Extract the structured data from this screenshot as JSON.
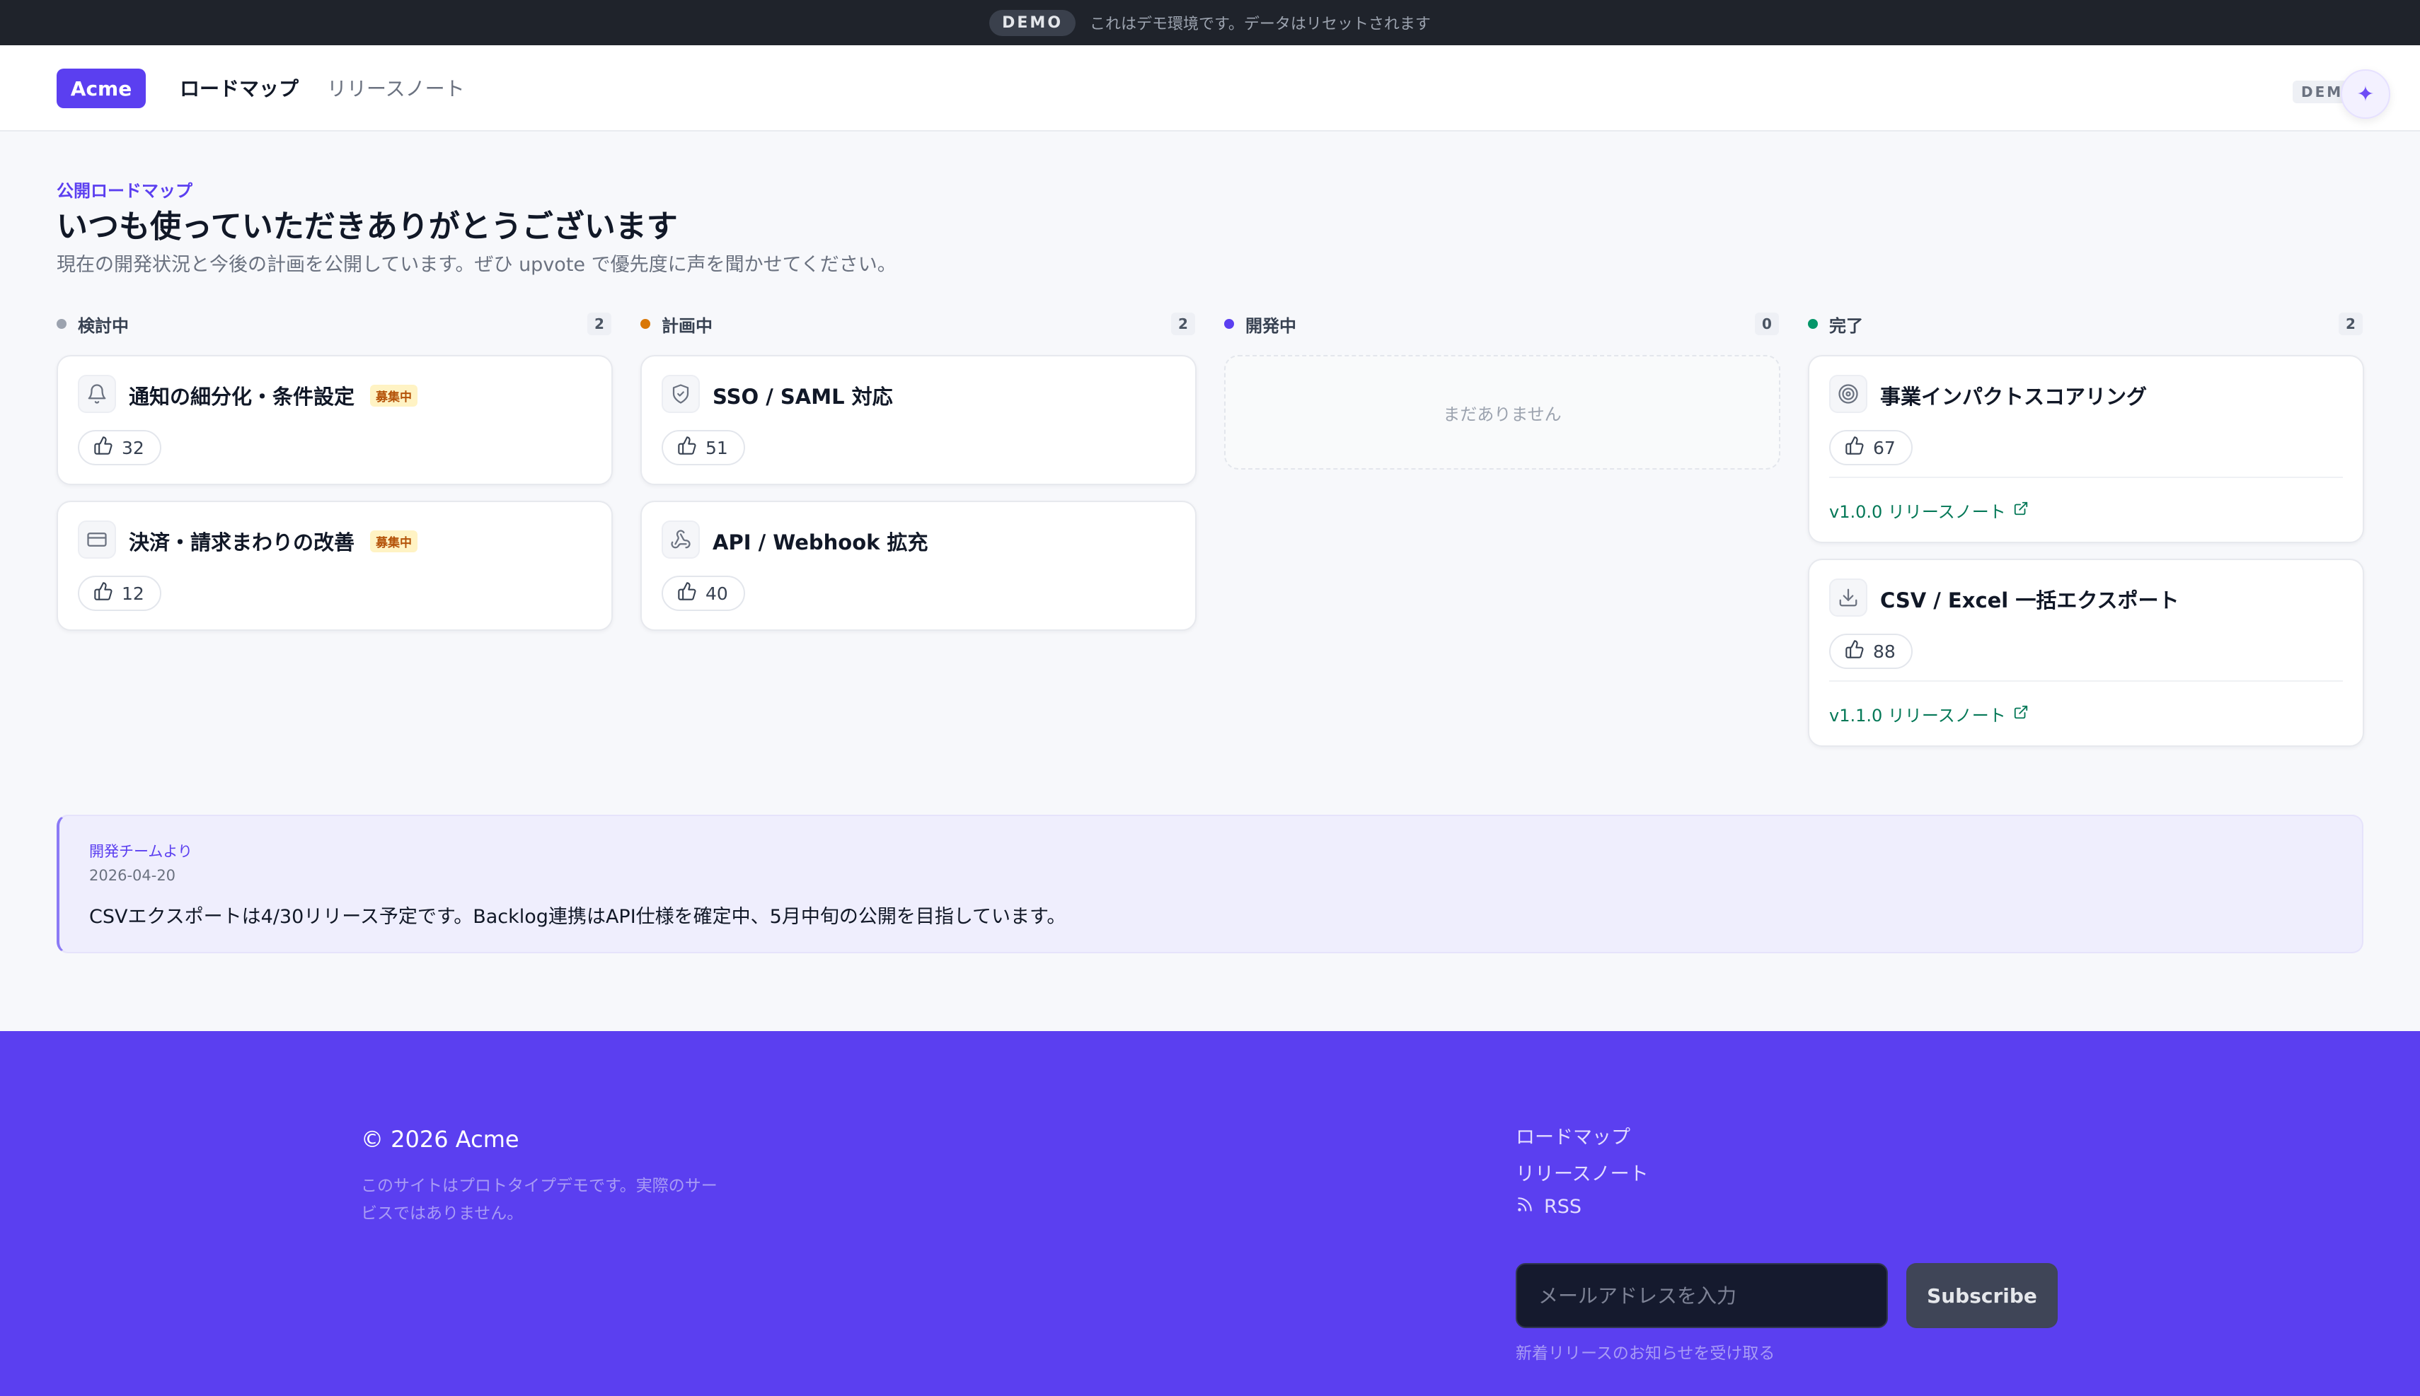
{
  "demo_banner": {
    "pill": "DEMO",
    "text": "これはデモ環境です。データはリセットされます"
  },
  "header": {
    "logo": "Acme",
    "nav": [
      {
        "label": "ロードマップ",
        "active": true
      },
      {
        "label": "リリースノート",
        "active": false
      }
    ],
    "demo_tag": "DEMO",
    "assistant_icon": "sparkle-icon"
  },
  "intro": {
    "eyebrow": "公開ロードマップ",
    "title": "いつも使っていただきありがとうございます",
    "description": "現在の開発状況と今後の計画を公開しています。ぜひ upvote で優先度に声を聞かせてください。"
  },
  "columns": [
    {
      "label": "検討中",
      "count": "2",
      "color": "#9ca3af",
      "cards": [
        {
          "icon": "bell-icon",
          "title": "通知の細分化・条件設定",
          "badge": "募集中",
          "votes": "32"
        },
        {
          "icon": "credit-card-icon",
          "title": "決済・請求まわりの改善",
          "badge": "募集中",
          "votes": "12"
        }
      ]
    },
    {
      "label": "計画中",
      "count": "2",
      "color": "#d97706",
      "cards": [
        {
          "icon": "shield-check-icon",
          "title": "SSO / SAML 対応",
          "votes": "51"
        },
        {
          "icon": "webhook-icon",
          "title": "API / Webhook 拡充",
          "votes": "40"
        }
      ]
    },
    {
      "label": "開発中",
      "count": "0",
      "color": "#5b3ff0",
      "empty_text": "まだありません",
      "cards": []
    },
    {
      "label": "完了",
      "count": "2",
      "color": "#059669",
      "cards": [
        {
          "icon": "target-icon",
          "title": "事業インパクトスコアリング",
          "votes": "67",
          "release": "v1.0.0 リリースノート"
        },
        {
          "icon": "download-icon",
          "title": "CSV / Excel 一括エクスポート",
          "votes": "88",
          "release": "v1.1.0 リリースノート"
        }
      ]
    }
  ],
  "team_note": {
    "label": "開発チームより",
    "date": "2026-04-20",
    "body": "CSVエクスポートは4/30リリース予定です。Backlog連携はAPI仕様を確定中、5月中旬の公開を目指しています。"
  },
  "footer": {
    "copyright": "© 2026 Acme",
    "note": "このサイトはプロトタイプデモです。実際のサービスではありません。",
    "links": [
      "ロードマップ",
      "リリースノート"
    ],
    "rss": "RSS",
    "email_placeholder": "メールアドレスを入力",
    "subscribe_label": "Subscribe",
    "subscribe_hint": "新着リリースのお知らせを受け取る"
  },
  "colors": {
    "brand": "#5b3ff0",
    "footer_bg": "#5b3ff0",
    "banner_bg": "#1f232b"
  }
}
